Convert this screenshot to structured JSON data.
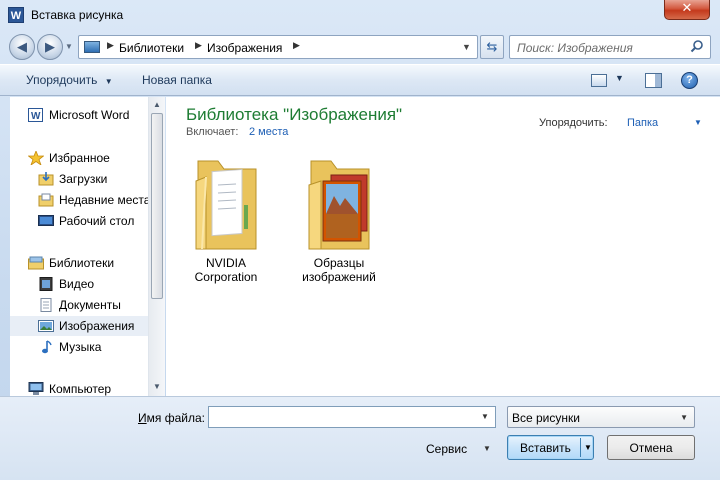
{
  "window": {
    "title": "Вставка рисунка",
    "close_label": "✕"
  },
  "address": {
    "crumbs": [
      "Библиотеки",
      "Изображения"
    ],
    "search_placeholder": "Поиск: Изображения"
  },
  "toolbar": {
    "organize_label": "Упорядочить",
    "new_folder_label": "Новая папка"
  },
  "navigation": {
    "items": [
      {
        "label": "Microsoft Word",
        "icon": "word-doc-icon",
        "selected": false
      },
      {
        "label": "Избранное",
        "icon": "star-icon",
        "selected": false
      },
      {
        "label": "Загрузки",
        "icon": "downloads-icon",
        "selected": false
      },
      {
        "label": "Недавние места",
        "icon": "recent-places-icon",
        "selected": false
      },
      {
        "label": "Рабочий стол",
        "icon": "desktop-icon",
        "selected": false
      },
      {
        "label": "Библиотеки",
        "icon": "libraries-icon",
        "selected": false
      },
      {
        "label": "Видео",
        "icon": "video-icon",
        "selected": false
      },
      {
        "label": "Документы",
        "icon": "documents-icon",
        "selected": false
      },
      {
        "label": "Изображения",
        "icon": "pictures-icon",
        "selected": true
      },
      {
        "label": "Музыка",
        "icon": "music-icon",
        "selected": false
      },
      {
        "label": "Компьютер",
        "icon": "computer-icon",
        "selected": false
      }
    ]
  },
  "library": {
    "title": "Библиотека \"Изображения\"",
    "includes_label": "Включает:",
    "includes_link": "2 места",
    "arrange_label": "Упорядочить:",
    "arrange_value": "Папка",
    "folders": [
      {
        "name_line1": "NVIDIA",
        "name_line2": "Corporation",
        "icon": "folder-documents-icon"
      },
      {
        "name_line1": "Образцы",
        "name_line2": "изображений",
        "icon": "folder-pictures-icon"
      }
    ]
  },
  "footer": {
    "filename_label": "Имя файла:",
    "filename_value": "",
    "filter_value": "Все рисунки",
    "service_label": "Сервис",
    "insert_label": "Вставить",
    "cancel_label": "Отмена"
  },
  "colors": {
    "library_title": "#1e7c33",
    "link": "#1e5fb5",
    "close_button": "#c4391c"
  }
}
